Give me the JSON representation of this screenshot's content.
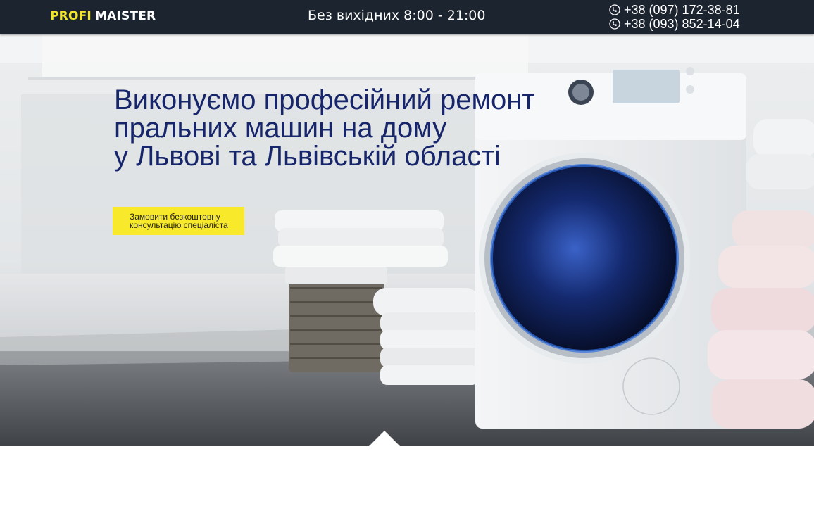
{
  "header": {
    "logo_part1": "PROFI",
    "logo_part2": "MAISTER",
    "hours": "Без вихідних 8:00 - 21:00",
    "phones": [
      "+38 (097) 172-38-81",
      "+38 (093) 852-14-04"
    ],
    "phone_icon": "phone-handset-icon"
  },
  "hero": {
    "headline": [
      "Виконуємо професійний ремонт",
      "пральних машин на дому",
      "у Львові та Львівській області"
    ],
    "cta_lines": [
      "Замовити безкоштовну",
      "консультацію спеціаліста"
    ]
  },
  "colors": {
    "header_bg": "#1c2430",
    "logo_accent": "#f2e52a",
    "headline": "#17256b",
    "cta_bg": "#f8ea2a"
  }
}
